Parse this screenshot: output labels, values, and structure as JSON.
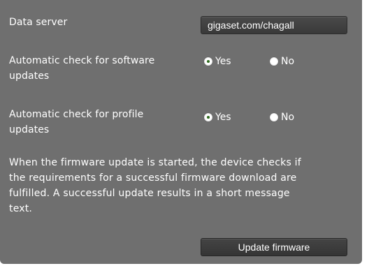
{
  "data_server": {
    "label": "Data server",
    "value": "gigaset.com/chagall"
  },
  "software_updates": {
    "label_line1": "Automatic check for software",
    "label_line2": "updates",
    "options": [
      {
        "label": "Yes",
        "checked": true
      },
      {
        "label": "No",
        "checked": false
      }
    ]
  },
  "profile_updates": {
    "label_line1": "Automatic check for profile",
    "label_line2": "updates",
    "options": [
      {
        "label": "Yes",
        "checked": true
      },
      {
        "label": "No",
        "checked": false
      }
    ]
  },
  "info_text": {
    "line1": "When the firmware update is started, the device checks if",
    "line2": "the requirements for a successful firmware download are",
    "line3": "fulfilled. A successful update results in a short message",
    "line4": "text."
  },
  "update_button": {
    "label": "Update firmware"
  },
  "colors": {
    "panel_bg": "#6f6f6f",
    "field_bg": "#3f3f3f",
    "radio_check": "#2f6b1e",
    "text": "#ffffff"
  }
}
